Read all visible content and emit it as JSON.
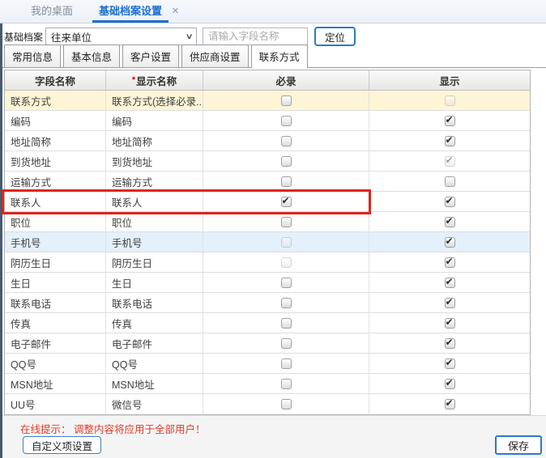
{
  "window_tabs": {
    "items": [
      {
        "label": "我的桌面",
        "active": false
      },
      {
        "label": "基础档案设置",
        "active": true
      }
    ],
    "close_icon": "×"
  },
  "toolbar": {
    "label": "基础档案",
    "archive_select": {
      "value": "往来单位"
    },
    "search_input": {
      "value": "",
      "placeholder": "请输入字段名称"
    },
    "locate_button": "定位"
  },
  "subtabs": {
    "items": [
      "常用信息",
      "基本信息",
      "客户设置",
      "供应商设置",
      "联系方式"
    ],
    "active": "联系方式"
  },
  "table": {
    "headers": {
      "field": "字段名称",
      "display": "显示名称",
      "required": "必录",
      "show": "显示"
    },
    "required_marker": "*",
    "rows": [
      {
        "field": "联系方式",
        "display": "联系方式(选择必录...",
        "required_checked": false,
        "required_disabled": false,
        "show_checked": false,
        "show_disabled": true,
        "row_style": "yellow"
      },
      {
        "field": "编码",
        "display": "编码",
        "required_checked": false,
        "required_disabled": false,
        "show_checked": true,
        "show_disabled": false,
        "row_style": ""
      },
      {
        "field": "地址简称",
        "display": "地址简称",
        "required_checked": false,
        "required_disabled": false,
        "show_checked": true,
        "show_disabled": false,
        "row_style": ""
      },
      {
        "field": "到货地址",
        "display": "到货地址",
        "required_checked": false,
        "required_disabled": false,
        "show_checked": true,
        "show_disabled": true,
        "row_style": ""
      },
      {
        "field": "运输方式",
        "display": "运输方式",
        "required_checked": false,
        "required_disabled": false,
        "show_checked": false,
        "show_disabled": false,
        "row_style": ""
      },
      {
        "field": "联系人",
        "display": "联系人",
        "required_checked": true,
        "required_disabled": false,
        "show_checked": true,
        "show_disabled": false,
        "row_style": "",
        "annotated": true
      },
      {
        "field": "职位",
        "display": "职位",
        "required_checked": false,
        "required_disabled": false,
        "show_checked": true,
        "show_disabled": false,
        "row_style": ""
      },
      {
        "field": "手机号",
        "display": "手机号",
        "required_checked": false,
        "required_disabled": true,
        "show_checked": true,
        "show_disabled": false,
        "row_style": "blue"
      },
      {
        "field": "阴历生日",
        "display": "阴历生日",
        "required_checked": false,
        "required_disabled": true,
        "show_checked": true,
        "show_disabled": false,
        "row_style": ""
      },
      {
        "field": "生日",
        "display": "生日",
        "required_checked": false,
        "required_disabled": false,
        "show_checked": true,
        "show_disabled": false,
        "row_style": ""
      },
      {
        "field": "联系电话",
        "display": "联系电话",
        "required_checked": false,
        "required_disabled": false,
        "show_checked": true,
        "show_disabled": false,
        "row_style": ""
      },
      {
        "field": "传真",
        "display": "传真",
        "required_checked": false,
        "required_disabled": false,
        "show_checked": true,
        "show_disabled": false,
        "row_style": ""
      },
      {
        "field": "电子邮件",
        "display": "电子邮件",
        "required_checked": false,
        "required_disabled": false,
        "show_checked": true,
        "show_disabled": false,
        "row_style": ""
      },
      {
        "field": "QQ号",
        "display": "QQ号",
        "required_checked": false,
        "required_disabled": false,
        "show_checked": true,
        "show_disabled": false,
        "row_style": ""
      },
      {
        "field": "MSN地址",
        "display": "MSN地址",
        "required_checked": false,
        "required_disabled": false,
        "show_checked": true,
        "show_disabled": false,
        "row_style": ""
      },
      {
        "field": "UU号",
        "display": "微信号",
        "required_checked": false,
        "required_disabled": false,
        "show_checked": true,
        "show_disabled": false,
        "row_style": ""
      }
    ]
  },
  "annotation": {
    "type": "red-highlight-box",
    "target_row": "联系人",
    "color": "#e0241b"
  },
  "footer": {
    "tip": "在线提示： 调整内容将应用于全部用户！",
    "custom_settings_button": "自定义项设置",
    "save_button": "保存"
  },
  "colors": {
    "accent_blue": "#2b7ac7",
    "active_tab_blue": "#1e6fd0",
    "warning_red": "#e23b2b",
    "annotation_red": "#e0241b",
    "yellow_row": "#fdf5d6",
    "blue_row": "#e4f0fb"
  }
}
